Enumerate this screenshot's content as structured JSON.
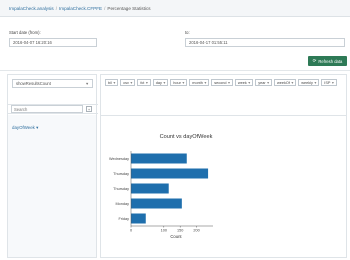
{
  "breadcrumb": {
    "items": [
      "ImpalaCheck.analysis",
      "ImpalaCheck.CFPFE"
    ],
    "current": "Percentage Statistics"
  },
  "start": {
    "label": "Start date (from):",
    "value": "2016-04-07 16:20:16"
  },
  "end": {
    "label": "to:",
    "value": "2016-04-17 01:55:11"
  },
  "refresh": {
    "icon": "refresh-icon",
    "label": "Refresh data"
  },
  "left": {
    "dimension_select": "showResultsCount",
    "filter_placeholder": "Search",
    "filter_button": "+",
    "selected_dimension": "dayOfWeek"
  },
  "chips": [
    "bil",
    "csv",
    "fct",
    "day",
    "hour",
    "month",
    "second",
    "week",
    "year",
    "weekOf",
    "weekly",
    "ISP"
  ],
  "chart_data": {
    "type": "bar",
    "orientation": "horizontal",
    "title": "Count vs dayOfWeek",
    "xlabel": "Count",
    "ylabel": "",
    "categories": [
      "Wednesday",
      "Thursday",
      "Thursday",
      "Monday",
      "Friday"
    ],
    "values": [
      170,
      235,
      115,
      155,
      45
    ],
    "xlim": [
      0,
      250
    ],
    "xticks": [
      0,
      100,
      150,
      200
    ],
    "bar_color": "#1f6fad",
    "grid": false
  }
}
